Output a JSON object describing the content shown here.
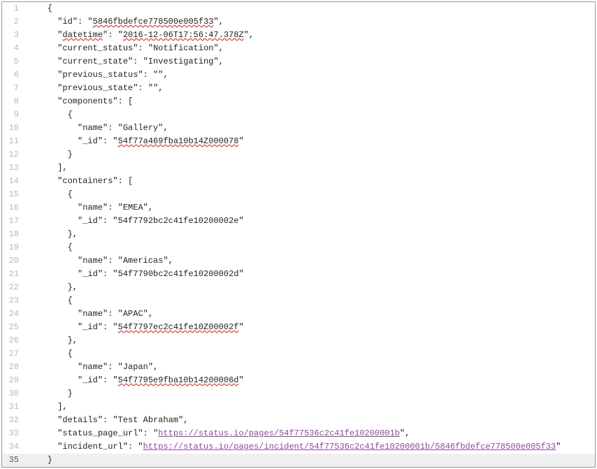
{
  "lines": [
    {
      "n": "1",
      "indent": "    ",
      "text": "{",
      "type": "plain"
    },
    {
      "n": "2",
      "indent": "      ",
      "key": "id",
      "value": "5846fbdefce778500e005f33",
      "spell": true,
      "comma": true
    },
    {
      "n": "3",
      "indent": "      ",
      "key": "datetime",
      "value": "2016-12-06T17:56:47.378Z",
      "spell": true,
      "comma": true,
      "dblspell": true
    },
    {
      "n": "4",
      "indent": "      ",
      "key": "current_status",
      "value": "Notification",
      "comma": true
    },
    {
      "n": "5",
      "indent": "      ",
      "key": "current_state",
      "value": "Investigating",
      "comma": true
    },
    {
      "n": "6",
      "indent": "      ",
      "key": "previous_status",
      "value": "",
      "comma": true
    },
    {
      "n": "7",
      "indent": "      ",
      "key": "previous_state",
      "value": "",
      "comma": true
    },
    {
      "n": "8",
      "indent": "      ",
      "key": "components",
      "after": ": [",
      "arrayopen": true
    },
    {
      "n": "9",
      "indent": "        ",
      "text": "{",
      "type": "plain"
    },
    {
      "n": "10",
      "indent": "          ",
      "key": "name",
      "value": "Gallery",
      "comma": true
    },
    {
      "n": "11",
      "indent": "          ",
      "key": "_id",
      "value": "54f77a469fba10b14Z000078",
      "spell": true
    },
    {
      "n": "12",
      "indent": "        ",
      "text": "}",
      "type": "plain"
    },
    {
      "n": "13",
      "indent": "      ",
      "text": "],",
      "type": "plain"
    },
    {
      "n": "14",
      "indent": "      ",
      "key": "containers",
      "after": ": [",
      "arrayopen": true
    },
    {
      "n": "15",
      "indent": "        ",
      "text": "{",
      "type": "plain"
    },
    {
      "n": "16",
      "indent": "          ",
      "key": "name",
      "value": "EMEA",
      "comma": true
    },
    {
      "n": "17",
      "indent": "          ",
      "key": "_id",
      "value": "54f7792bc2c41fe10200002e"
    },
    {
      "n": "18",
      "indent": "        ",
      "text": "},",
      "type": "plain"
    },
    {
      "n": "19",
      "indent": "        ",
      "text": "{",
      "type": "plain"
    },
    {
      "n": "20",
      "indent": "          ",
      "key": "name",
      "value": "Americas",
      "comma": true
    },
    {
      "n": "21",
      "indent": "          ",
      "key": "_id",
      "value": "54f7790bc2c41fe10200002d"
    },
    {
      "n": "22",
      "indent": "        ",
      "text": "},",
      "type": "plain"
    },
    {
      "n": "23",
      "indent": "        ",
      "text": "{",
      "type": "plain"
    },
    {
      "n": "24",
      "indent": "          ",
      "key": "name",
      "value": "APAC",
      "comma": true
    },
    {
      "n": "25",
      "indent": "          ",
      "key": "_id",
      "value": "54f7797ec2c41fe10Z00002f",
      "spell": true
    },
    {
      "n": "26",
      "indent": "        ",
      "text": "},",
      "type": "plain"
    },
    {
      "n": "27",
      "indent": "        ",
      "text": "{",
      "type": "plain"
    },
    {
      "n": "28",
      "indent": "          ",
      "key": "name",
      "value": "Japan",
      "comma": true
    },
    {
      "n": "29",
      "indent": "          ",
      "key": "_id",
      "value": "54f7795e9fba10b14200006d",
      "spell": true
    },
    {
      "n": "30",
      "indent": "        ",
      "text": "}",
      "type": "plain"
    },
    {
      "n": "31",
      "indent": "      ",
      "text": "],",
      "type": "plain"
    },
    {
      "n": "32",
      "indent": "      ",
      "key": "details",
      "value": "Test Abraham",
      "comma": true
    },
    {
      "n": "33",
      "indent": "      ",
      "key": "status_page_url",
      "url": "https://status.io/pages/54f77536c2c41fe10200001b",
      "comma": true
    },
    {
      "n": "34",
      "indent": "      ",
      "key": "incident_url",
      "url": "https://status.io/pages/incident/54f77536c2c41fe10200001b/5846fbdefce778500e005f33"
    },
    {
      "n": "35",
      "indent": "    ",
      "text": "}",
      "type": "plain",
      "active": true
    }
  ]
}
